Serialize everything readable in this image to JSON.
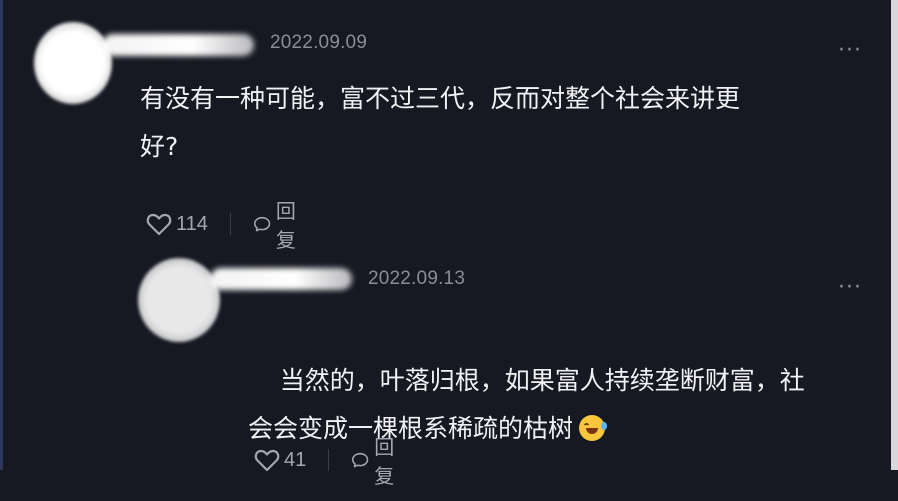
{
  "comments": [
    {
      "date": "2022.09.09",
      "text": "有没有一种可能，富不过三代，反而对整个社会来讲更\n好?",
      "likes": "114",
      "reply_label": "回复",
      "more_label": "···"
    },
    {
      "date": "2022.09.13",
      "text_line1": "当然的，叶落归根，如果富人持续垄断财富，社",
      "text_line2": "会会变成一棵根系稀疏的枯树",
      "emoji": "rolling-on-floor-laughing",
      "likes": "41",
      "reply_label": "回复",
      "more_label": "···"
    }
  ],
  "colors": {
    "background": "#161822",
    "text": "#f2f2f4",
    "muted": "#8a8d98"
  }
}
